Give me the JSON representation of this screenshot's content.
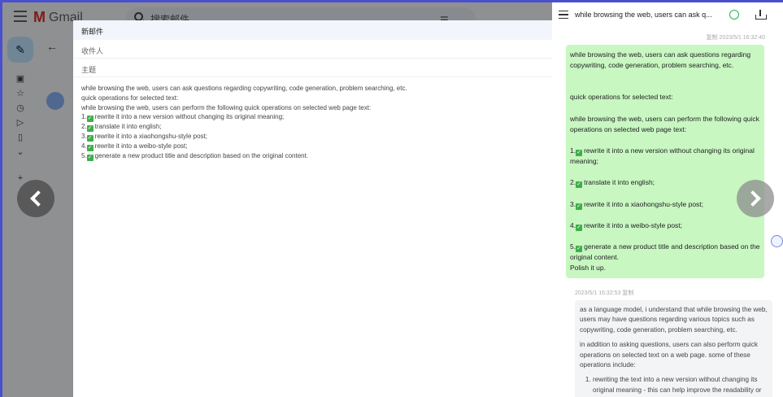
{
  "gmail": {
    "logo_text": "Gmail",
    "search_placeholder": "搜索邮件"
  },
  "compose": {
    "title": "新邮件",
    "to_label": "收件人",
    "subject_label": "主题",
    "body_lines": [
      {
        "prefix": "",
        "check": false,
        "text": "while browsing the web, users can ask questions regarding copywriting, code generation, problem searching, etc."
      },
      {
        "prefix": "",
        "check": false,
        "text": "quick operations for selected text:"
      },
      {
        "prefix": "",
        "check": false,
        "text": "while browsing the web, users can perform the following quick operations on selected web page text:"
      },
      {
        "prefix": "1.",
        "check": true,
        "text": "rewrite it into a new version without changing its original meaning;"
      },
      {
        "prefix": "2.",
        "check": true,
        "text": "translate it into english;"
      },
      {
        "prefix": "3.",
        "check": true,
        "text": "rewrite it into a xiaohongshu-style post;"
      },
      {
        "prefix": "4.",
        "check": true,
        "text": "rewrite it into a weibo-style post;"
      },
      {
        "prefix": "5.",
        "check": true,
        "text": "generate a new product title and description based on the original content."
      }
    ]
  },
  "panel": {
    "title": "while browsing the web, users can ask q...",
    "user_timestamp": "复制 2023/5/1 16:32:40",
    "user_message": {
      "p1": "while browsing the web, users can ask questions regarding copywriting, code generation, problem searching, etc.",
      "p2": "quick operations for selected text:",
      "p3": "while browsing the web, users can perform the following quick operations on selected web page text:",
      "items": [
        "rewrite it into a new version without changing its original meaning;",
        "translate it into english;",
        "rewrite it into a xiaohongshu-style post;",
        "rewrite it into a weibo-style post;",
        "generate a new product title and description based on the original content."
      ],
      "closing": "Polish it up."
    },
    "ai_timestamp": "2023/5/1 16:32:53 复制",
    "ai_message": {
      "p1": "as a language model, i understand that while browsing the web, users may have questions regarding various topics such as copywriting, code generation, problem searching, etc.",
      "p2": "in addition to asking questions, users can also perform quick operations on selected text on a web page. some of these operations include:",
      "li1": "rewriting the text into a new version without changing its original meaning - this can help improve the readability or"
    }
  },
  "icons": {
    "check": "✓"
  }
}
